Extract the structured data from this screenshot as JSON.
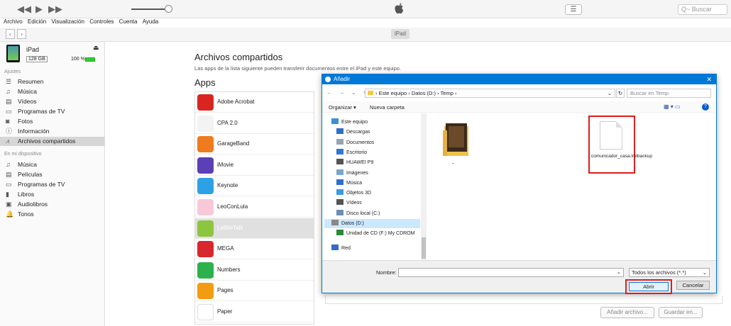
{
  "toolbar": {
    "search_placeholder": "Q~ Buscar"
  },
  "menu": [
    "Archivo",
    "Edición",
    "Visualización",
    "Controles",
    "Cuenta",
    "Ayuda"
  ],
  "device": {
    "name": "iPad",
    "capacity": "128 GB",
    "battery": "100 %",
    "tab": "iPad"
  },
  "sidebar": {
    "section_settings": "Ajustes",
    "settings": [
      {
        "icon": "summary-icon",
        "label": "Resumen"
      },
      {
        "icon": "music-icon",
        "label": "Música"
      },
      {
        "icon": "film-icon",
        "label": "Vídeos"
      },
      {
        "icon": "tv-icon",
        "label": "Programas de TV"
      },
      {
        "icon": "camera-icon",
        "label": "Fotos"
      },
      {
        "icon": "info-icon",
        "label": "Información"
      },
      {
        "icon": "apps-icon",
        "label": "Archivos compartidos"
      }
    ],
    "section_device": "En mi dispositivo",
    "device_items": [
      {
        "icon": "music-icon",
        "label": "Música"
      },
      {
        "icon": "film-icon",
        "label": "Películas"
      },
      {
        "icon": "tv-icon",
        "label": "Programas de TV"
      },
      {
        "icon": "books-icon",
        "label": "Libros"
      },
      {
        "icon": "audiobook-icon",
        "label": "Audiolibros"
      },
      {
        "icon": "bell-icon",
        "label": "Tonos"
      }
    ]
  },
  "main": {
    "title": "Archivos compartidos",
    "subtitle": "Las apps de la lista siguiente pueden transferir documentos entre el iPad y este equipo.",
    "apps_heading": "Apps",
    "apps": [
      "Adobe Acrobat",
      "CPA 2.0",
      "GarageBand",
      "iMovie",
      "Keynote",
      "LeoConLula",
      "LetMeTalk",
      "MEGA",
      "Numbers",
      "Pages",
      "Paper"
    ],
    "app_colors": [
      "#d8251f",
      "#f3f3f3",
      "#f07a1e",
      "#5b3fb5",
      "#2ea0e6",
      "#f8c8d8",
      "#8cc63f",
      "#d9272e",
      "#2bb24c",
      "#f39c12",
      "#ffffff"
    ],
    "add_button": "Añadir archivo...",
    "save_button": "Guardar en..."
  },
  "dialog": {
    "title": "Añadir",
    "breadcrumb": "›  Este equipo  ›  Datos (D:)  ›  Temp  ›",
    "search_placeholder": "Buscar en Temp",
    "organize": "Organizar ▾",
    "new_folder": "Nueva carpeta",
    "tree": [
      {
        "icon": "pc-icon",
        "label": "Este equipo",
        "color": "#3a8fd6"
      },
      {
        "icon": "download-icon",
        "label": "Descargas",
        "color": "#2f6fc9"
      },
      {
        "icon": "document-icon",
        "label": "Documentos",
        "color": "#9aa4b0"
      },
      {
        "icon": "desktop-icon",
        "label": "Escritorio",
        "color": "#2f77d4"
      },
      {
        "icon": "phone-icon",
        "label": "HUAWEI P9",
        "color": "#555555"
      },
      {
        "icon": "image-icon",
        "label": "Imágenes",
        "color": "#7aa6c9"
      },
      {
        "icon": "music-icon",
        "label": "Música",
        "color": "#2f6fc9"
      },
      {
        "icon": "cube-icon",
        "label": "Objetos 3D",
        "color": "#3b9be0"
      },
      {
        "icon": "film-icon",
        "label": "Vídeos",
        "color": "#555555"
      },
      {
        "icon": "drive-icon",
        "label": "Disco local (C:)",
        "color": "#6c8fb5"
      },
      {
        "icon": "drive-icon",
        "label": "Datos (D:)",
        "color": "#888888"
      },
      {
        "icon": "cd-icon",
        "label": "Unidad de CD (F:) My CDROM",
        "color": "#2a8a3a"
      },
      {
        "icon": "network-icon",
        "label": "Red",
        "color": "#2f6fc9"
      }
    ],
    "folder_label": "-",
    "file_name": "comunicador_casa.lmtbackup",
    "name_label": "Nombre:",
    "file_type": "Todos los archivos (*.*)",
    "open_button": "Abrir",
    "cancel_button": "Cancelar"
  }
}
